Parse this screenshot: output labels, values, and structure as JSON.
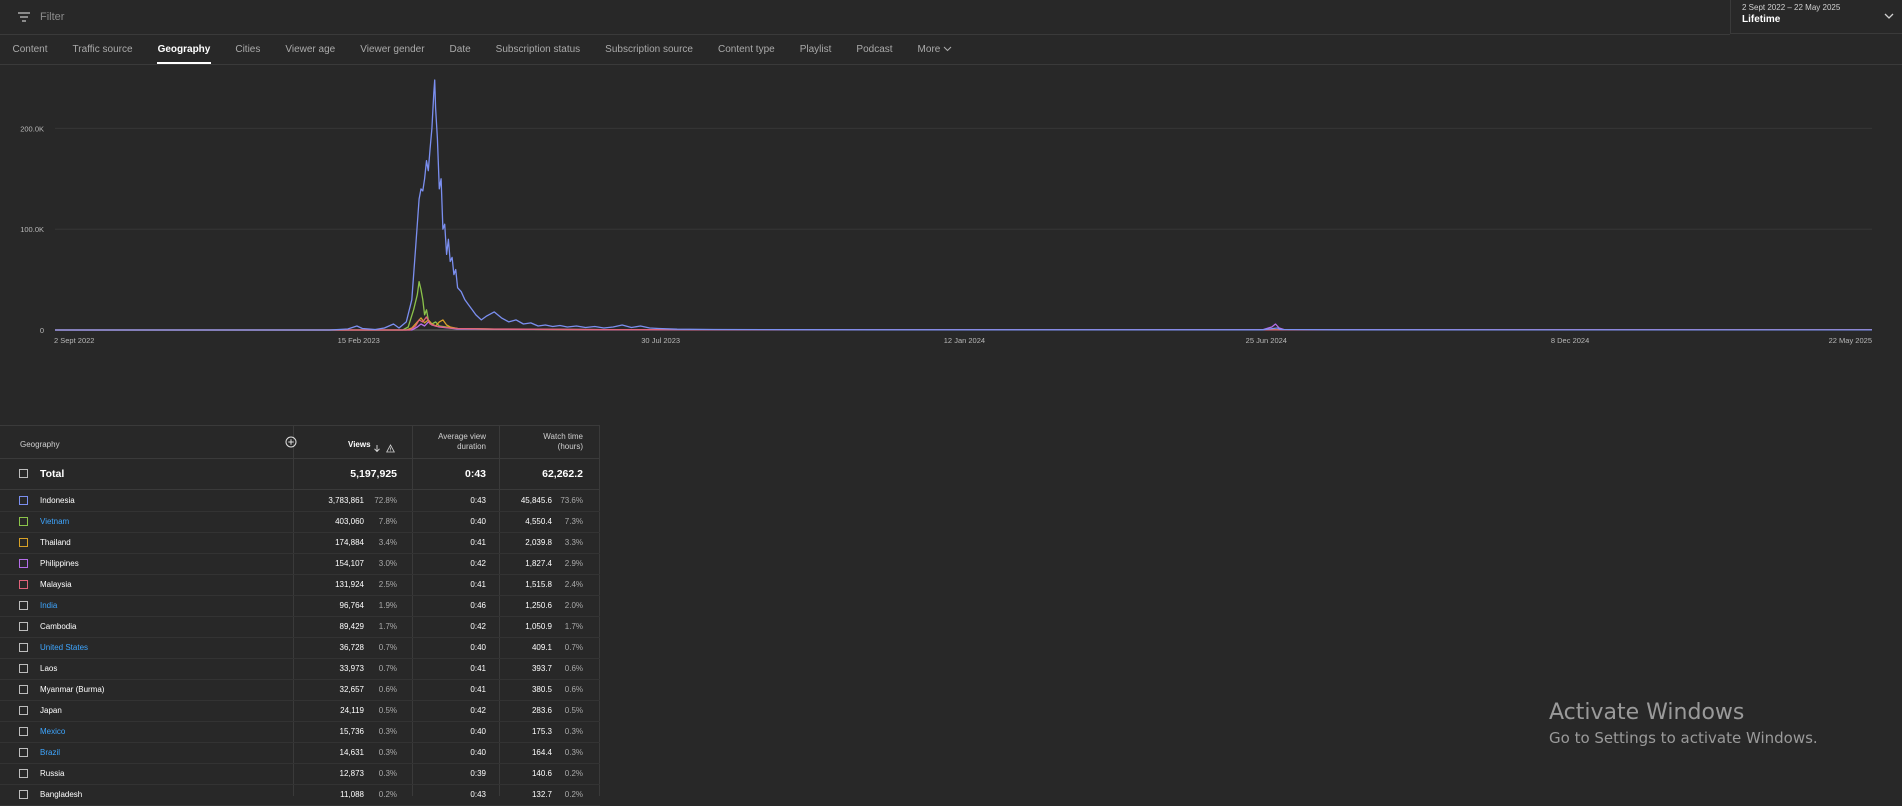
{
  "filter": {
    "placeholder": "Filter",
    "icon": "filter-icon"
  },
  "date_range": {
    "range": "2 Sept 2022 – 22 May 2025",
    "period": "Lifetime"
  },
  "tabs": [
    {
      "label": "Content"
    },
    {
      "label": "Traffic source"
    },
    {
      "label": "Geography",
      "active": true
    },
    {
      "label": "Cities"
    },
    {
      "label": "Viewer age"
    },
    {
      "label": "Viewer gender"
    },
    {
      "label": "Date"
    },
    {
      "label": "Subscription status"
    },
    {
      "label": "Subscription source"
    },
    {
      "label": "Content type"
    },
    {
      "label": "Playlist"
    },
    {
      "label": "Podcast"
    },
    {
      "label": "More"
    }
  ],
  "chart_data": {
    "type": "line",
    "x_tick_labels": [
      "2 Sept 2022",
      "15 Feb 2023",
      "30 Jul 2023",
      "12 Jan 2024",
      "25 Jun 2024",
      "8 Dec 2024",
      "22 May 2025"
    ],
    "y_tick_labels": [
      "0",
      "100.0K",
      "200.0K"
    ],
    "ylim": [
      0,
      250000
    ],
    "grid": true,
    "x_tick_values": [
      0,
      166,
      331,
      497,
      662,
      828,
      993
    ],
    "series": [
      {
        "name": "Indonesia",
        "color": "#7b8ff0",
        "points": [
          [
            0,
            0
          ],
          [
            150,
            0
          ],
          [
            160,
            1000
          ],
          [
            165,
            4000
          ],
          [
            168,
            1500
          ],
          [
            175,
            500
          ],
          [
            180,
            2000
          ],
          [
            185,
            6000
          ],
          [
            188,
            2000
          ],
          [
            192,
            8000
          ],
          [
            195,
            30000
          ],
          [
            197,
            80000
          ],
          [
            199,
            130000
          ],
          [
            200,
            140000
          ],
          [
            201,
            138000
          ],
          [
            202,
            150000
          ],
          [
            203,
            168000
          ],
          [
            204,
            158000
          ],
          [
            205,
            180000
          ],
          [
            206,
            200000
          ],
          [
            207,
            235000
          ],
          [
            207.5,
            248000
          ],
          [
            208,
            220000
          ],
          [
            209,
            190000
          ],
          [
            210,
            140000
          ],
          [
            211,
            150000
          ],
          [
            212,
            100000
          ],
          [
            213,
            105000
          ],
          [
            214,
            75000
          ],
          [
            215,
            90000
          ],
          [
            216,
            68000
          ],
          [
            217,
            72000
          ],
          [
            218,
            55000
          ],
          [
            219,
            60000
          ],
          [
            220,
            42000
          ],
          [
            222,
            38000
          ],
          [
            224,
            30000
          ],
          [
            226,
            25000
          ],
          [
            228,
            20000
          ],
          [
            230,
            15000
          ],
          [
            233,
            10000
          ],
          [
            236,
            14000
          ],
          [
            240,
            18000
          ],
          [
            244,
            12000
          ],
          [
            248,
            8000
          ],
          [
            252,
            10000
          ],
          [
            256,
            6000
          ],
          [
            260,
            7000
          ],
          [
            264,
            4000
          ],
          [
            268,
            5000
          ],
          [
            272,
            3500
          ],
          [
            276,
            4500
          ],
          [
            280,
            3000
          ],
          [
            285,
            4000
          ],
          [
            290,
            2500
          ],
          [
            295,
            3500
          ],
          [
            300,
            2000
          ],
          [
            305,
            3000
          ],
          [
            310,
            5000
          ],
          [
            315,
            2500
          ],
          [
            320,
            4000
          ],
          [
            325,
            2000
          ],
          [
            330,
            1500
          ],
          [
            340,
            800
          ],
          [
            360,
            500
          ],
          [
            400,
            300
          ],
          [
            450,
            200
          ],
          [
            500,
            200
          ],
          [
            560,
            150
          ],
          [
            600,
            150
          ],
          [
            660,
            200
          ],
          [
            668,
            2000
          ],
          [
            670,
            500
          ],
          [
            700,
            150
          ],
          [
            800,
            100
          ],
          [
            900,
            100
          ],
          [
            993,
            100
          ]
        ]
      },
      {
        "name": "Vietnam",
        "color": "#8bc34a",
        "points": [
          [
            0,
            0
          ],
          [
            190,
            0
          ],
          [
            193,
            3000
          ],
          [
            196,
            20000
          ],
          [
            198,
            35000
          ],
          [
            199,
            48000
          ],
          [
            200,
            40000
          ],
          [
            201,
            30000
          ],
          [
            202,
            15000
          ],
          [
            203,
            20000
          ],
          [
            204,
            10000
          ],
          [
            206,
            6000
          ],
          [
            208,
            8000
          ],
          [
            210,
            4000
          ],
          [
            214,
            3000
          ],
          [
            220,
            1500
          ],
          [
            240,
            800
          ],
          [
            300,
            300
          ],
          [
            400,
            100
          ],
          [
            993,
            100
          ]
        ]
      },
      {
        "name": "Thailand",
        "color": "#d7a127",
        "points": [
          [
            0,
            0
          ],
          [
            192,
            0
          ],
          [
            195,
            2000
          ],
          [
            198,
            8000
          ],
          [
            200,
            12000
          ],
          [
            202,
            7000
          ],
          [
            204,
            10000
          ],
          [
            206,
            6000
          ],
          [
            208,
            4000
          ],
          [
            210,
            8000
          ],
          [
            212,
            10000
          ],
          [
            214,
            5000
          ],
          [
            216,
            3000
          ],
          [
            220,
            1500
          ],
          [
            240,
            800
          ],
          [
            300,
            300
          ],
          [
            400,
            100
          ],
          [
            993,
            100
          ]
        ]
      },
      {
        "name": "Philippines",
        "color": "#b56ee8",
        "points": [
          [
            0,
            0
          ],
          [
            195,
            0
          ],
          [
            198,
            3000
          ],
          [
            200,
            6000
          ],
          [
            202,
            4000
          ],
          [
            204,
            8000
          ],
          [
            206,
            5000
          ],
          [
            210,
            3000
          ],
          [
            220,
            1000
          ],
          [
            300,
            300
          ],
          [
            660,
            300
          ],
          [
            665,
            3000
          ],
          [
            667,
            6000
          ],
          [
            669,
            2000
          ],
          [
            672,
            300
          ],
          [
            993,
            100
          ]
        ]
      },
      {
        "name": "Malaysia",
        "color": "#e0637a",
        "points": [
          [
            0,
            0
          ],
          [
            194,
            0
          ],
          [
            197,
            4000
          ],
          [
            199,
            10000
          ],
          [
            201,
            8000
          ],
          [
            203,
            13000
          ],
          [
            205,
            6000
          ],
          [
            208,
            4000
          ],
          [
            212,
            3000
          ],
          [
            216,
            2000
          ],
          [
            220,
            1500
          ],
          [
            240,
            1000
          ],
          [
            300,
            400
          ],
          [
            400,
            200
          ],
          [
            993,
            100
          ]
        ]
      }
    ]
  },
  "table": {
    "headers": {
      "geography": "Geography",
      "views": "Views",
      "avd_line1": "Average view",
      "avd_line2": "duration",
      "wt_line1": "Watch time",
      "wt_line2": "(hours)"
    },
    "total": {
      "label": "Total",
      "views": "5,197,925",
      "avd": "0:43",
      "wt": "62,262.2"
    },
    "rows": [
      {
        "country": "Indonesia",
        "link": false,
        "color": "#7b8ff0",
        "views": "3,783,861",
        "vpct": "72.8%",
        "avd": "0:43",
        "wt": "45,845.6",
        "wpct": "73.6%"
      },
      {
        "country": "Vietnam",
        "link": true,
        "color": "#8bc34a",
        "views": "403,060",
        "vpct": "7.8%",
        "avd": "0:40",
        "wt": "4,550.4",
        "wpct": "7.3%"
      },
      {
        "country": "Thailand",
        "link": false,
        "color": "#d7a127",
        "views": "174,884",
        "vpct": "3.4%",
        "avd": "0:41",
        "wt": "2,039.8",
        "wpct": "3.3%"
      },
      {
        "country": "Philippines",
        "link": false,
        "color": "#b56ee8",
        "views": "154,107",
        "vpct": "3.0%",
        "avd": "0:42",
        "wt": "1,827.4",
        "wpct": "2.9%"
      },
      {
        "country": "Malaysia",
        "link": false,
        "color": "#e0637a",
        "views": "131,924",
        "vpct": "2.5%",
        "avd": "0:41",
        "wt": "1,515.8",
        "wpct": "2.4%"
      },
      {
        "country": "India",
        "link": true,
        "color": "",
        "views": "96,764",
        "vpct": "1.9%",
        "avd": "0:46",
        "wt": "1,250.6",
        "wpct": "2.0%"
      },
      {
        "country": "Cambodia",
        "link": false,
        "color": "",
        "views": "89,429",
        "vpct": "1.7%",
        "avd": "0:42",
        "wt": "1,050.9",
        "wpct": "1.7%"
      },
      {
        "country": "United States",
        "link": true,
        "color": "",
        "views": "36,728",
        "vpct": "0.7%",
        "avd": "0:40",
        "wt": "409.1",
        "wpct": "0.7%"
      },
      {
        "country": "Laos",
        "link": false,
        "color": "",
        "views": "33,973",
        "vpct": "0.7%",
        "avd": "0:41",
        "wt": "393.7",
        "wpct": "0.6%"
      },
      {
        "country": "Myanmar (Burma)",
        "link": false,
        "color": "",
        "views": "32,657",
        "vpct": "0.6%",
        "avd": "0:41",
        "wt": "380.5",
        "wpct": "0.6%"
      },
      {
        "country": "Japan",
        "link": false,
        "color": "",
        "views": "24,119",
        "vpct": "0.5%",
        "avd": "0:42",
        "wt": "283.6",
        "wpct": "0.5%"
      },
      {
        "country": "Mexico",
        "link": true,
        "color": "",
        "views": "15,736",
        "vpct": "0.3%",
        "avd": "0:40",
        "wt": "175.3",
        "wpct": "0.3%"
      },
      {
        "country": "Brazil",
        "link": true,
        "color": "",
        "views": "14,631",
        "vpct": "0.3%",
        "avd": "0:40",
        "wt": "164.4",
        "wpct": "0.3%"
      },
      {
        "country": "Russia",
        "link": false,
        "color": "",
        "views": "12,873",
        "vpct": "0.3%",
        "avd": "0:39",
        "wt": "140.6",
        "wpct": "0.2%"
      },
      {
        "country": "Bangladesh",
        "link": false,
        "color": "",
        "views": "11,088",
        "vpct": "0.2%",
        "avd": "0:43",
        "wt": "132.7",
        "wpct": "0.2%"
      }
    ]
  },
  "watermark": {
    "line1": "Activate Windows",
    "line2": "Go to Settings to activate Windows."
  }
}
